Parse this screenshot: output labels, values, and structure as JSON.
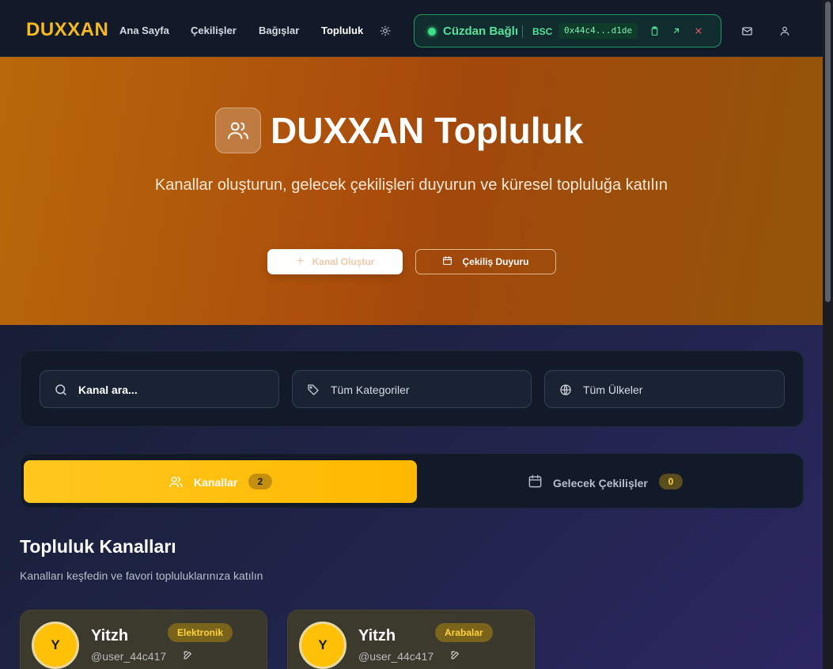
{
  "nav": {
    "logo": "DUXXAN",
    "links": [
      "Ana Sayfa",
      "Çekilişler",
      "Bağışlar",
      "Topluluk"
    ],
    "active_link": "Topluluk",
    "theme_icon": "sun-icon",
    "mail_icon": "mail-icon",
    "user_icon": "user-icon"
  },
  "wallet": {
    "status": "Cüzdan Bağlı",
    "chain": "BSC",
    "address": "0x44c4...d1de",
    "icons": [
      "copy-icon",
      "external-link-icon",
      "close-icon"
    ],
    "accent_color": "#3ee08a"
  },
  "hero": {
    "title": "DUXXAN Topluluk",
    "subtitle": "Kanallar oluşturun, gelecek çekilişleri duyurun ve küresel topluluğa katılın",
    "primary_button": "Kanal Oluştur",
    "secondary_button": "Çekiliş Duyuru"
  },
  "filters": {
    "search_placeholder": "Kanal ara...",
    "category_value": "Tüm Kategoriler",
    "country_value": "Tüm Ülkeler"
  },
  "tabs": [
    {
      "label": "Kanallar",
      "count": "2",
      "active": true
    },
    {
      "label": "Gelecek Çekilişler",
      "count": "0",
      "active": false
    }
  ],
  "section": {
    "title": "Topluluk Kanalları",
    "subtitle": "Kanalları keşfedin ve favori topluluklarınıza katılın"
  },
  "channels": [
    {
      "avatar_letter": "Y",
      "name": "Yitzh",
      "username": "@user_44c417",
      "category": "Elektronik"
    },
    {
      "avatar_letter": "Y",
      "name": "Yitzh",
      "username": "@user_44c417",
      "category": "Arabalar"
    }
  ],
  "colors": {
    "brand": "#f5b921",
    "tab_active": "#ffbe0f",
    "badge_bg": "#7a641b",
    "badge_text": "#ffd23c"
  }
}
